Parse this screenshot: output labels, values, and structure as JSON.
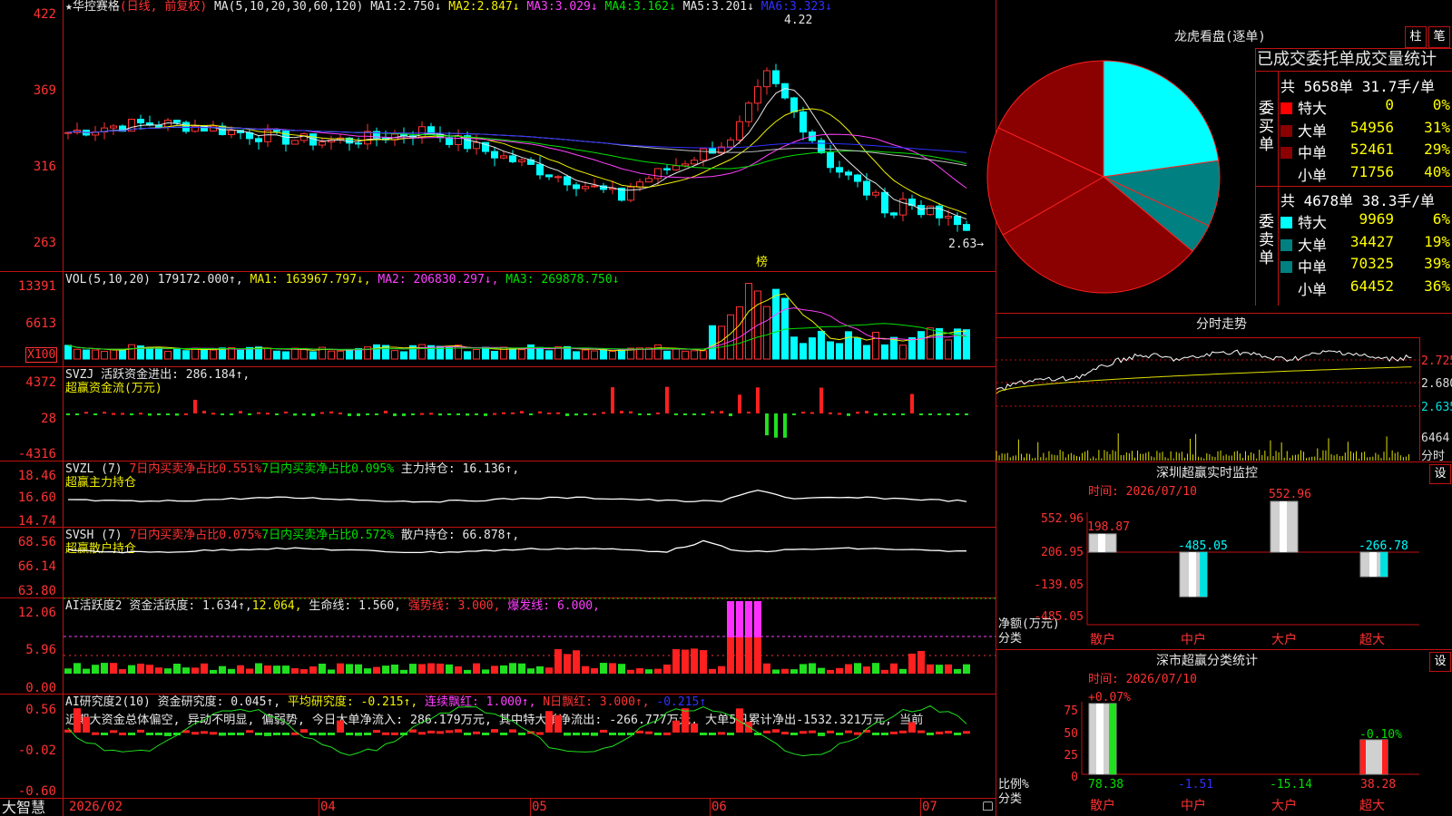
{
  "header": {
    "star": "★",
    "stock_name": "华控赛格",
    "mode": "(日线, 前复权)",
    "ma_params": "MA(5,10,20,30,60,120)",
    "ma": [
      {
        "label": "MA1:",
        "value": "2.750↓",
        "color": "#e6e6e6"
      },
      {
        "label": "MA2:",
        "value": "2.847↓",
        "color": "#f0f000"
      },
      {
        "label": "MA3:",
        "value": "3.029↓",
        "color": "#ff40ff"
      },
      {
        "label": "MA4:",
        "value": "3.162↓",
        "color": "#00e000"
      },
      {
        "label": "MA5:",
        "value": "3.201↓",
        "color": "#e6e6e6"
      },
      {
        "label": "MA6:",
        "value": "3.323↓",
        "color": "#3030ff"
      }
    ]
  },
  "main_chart": {
    "y_labels": [
      "422",
      "369",
      "316",
      "263"
    ],
    "high_label": "4.22",
    "low_label": "2.63→",
    "marker": "榜"
  },
  "vol": {
    "title": "VOL(5,10,20)",
    "value": "179172.000↑,",
    "ma1": "MA1: 163967.797↓,",
    "ma2": "MA2: 206830.297↓,",
    "ma3": "MA3: 269878.750↓",
    "y_labels": [
      "13391",
      "6613"
    ],
    "unit": "X100"
  },
  "svzj": {
    "title": "SVZJ",
    "text": "活跃资金进出: 286.184↑,",
    "sub": "超赢资金流(万元)",
    "y_labels": [
      "4372",
      "28",
      "-4316"
    ]
  },
  "svzl": {
    "title": "SVZL (7)",
    "red": "7日内买卖净占比0.551%",
    "green": "7日内买卖净占比0.095%",
    "white": "主力持仓: 16.136↑,",
    "sub": "超赢主力持仓",
    "y_labels": [
      "18.46",
      "16.60",
      "14.74"
    ]
  },
  "svsh": {
    "title": "SVSH (7)",
    "red": "7日内买卖净占比0.075%",
    "green": "7日内买卖净占比0.572%",
    "white": "散户持仓: 66.878↑,",
    "sub": "超赢散户持仓",
    "y_labels": [
      "68.56",
      "66.14",
      "63.80"
    ]
  },
  "ai_active": {
    "title": "AI活跃度2",
    "a": "资金活跃度: 1.634↑,",
    "b": "12.064,",
    "c": "生命线: 1.560,",
    "d": "强势线: 3.000,",
    "e": "爆发线: 6.000,",
    "y_labels": [
      "12.06",
      "5.96",
      "0.00"
    ]
  },
  "ai_research": {
    "title": "AI研究度2(10)",
    "a": "资金研究度: 0.045↑,",
    "b": "平均研究度: -0.215↑,",
    "c": "连续飘红: 1.000↑,",
    "d": "N日飘红: 3.000↑,",
    "e": "-0.215↑",
    "comment": "近期大资金总体偏空, 异动不明显, 偏弱势, 今日大单净流入: 286.179万元, 其中特大单净流出: -266.777万元, 大单5日累计净出-1532.321万元, 当前",
    "y_labels": [
      "0.56",
      "-0.02",
      "-0.60"
    ]
  },
  "bottom": {
    "brand": "大智慧",
    "dates": [
      "2026/02",
      "04",
      "05",
      "06",
      "07"
    ]
  },
  "lhb": {
    "title": "龙虎看盘(逐单)",
    "tab1": "柱",
    "tab2": "笔",
    "stats_title": "已成交委托单成交量统计",
    "buy_label": "委买单",
    "sell_label": "委卖单",
    "buy_total": "共 5658单 31.7手/单",
    "sell_total": "共 4678单 38.3手/单",
    "buy_rows": [
      {
        "name": "特大",
        "vol": "0",
        "pct": "0%",
        "color": "#ff0000"
      },
      {
        "name": "大单",
        "vol": "54956",
        "pct": "31%",
        "color": "#8b0000"
      },
      {
        "name": "中单",
        "vol": "52461",
        "pct": "29%",
        "color": "#8b0000"
      },
      {
        "name": "小单",
        "vol": "71756",
        "pct": "40%",
        "color": "#000000"
      }
    ],
    "sell_rows": [
      {
        "name": "特大",
        "vol": "9969",
        "pct": "6%",
        "color": "#00ffff"
      },
      {
        "name": "大单",
        "vol": "34427",
        "pct": "19%",
        "color": "#008080"
      },
      {
        "name": "中单",
        "vol": "70325",
        "pct": "39%",
        "color": "#008080"
      },
      {
        "name": "小单",
        "vol": "64452",
        "pct": "36%",
        "color": "#000000"
      }
    ]
  },
  "intraday": {
    "title": "分时走势",
    "y_labels": [
      "2.725",
      "2.680",
      "2.635"
    ],
    "vol_label": "6464",
    "vol_sub": "分时"
  },
  "sz_monitor": {
    "title": "深圳超赢实时监控",
    "btn": "设",
    "time": "时间: 2026/07/10",
    "y_labels": [
      "552.96",
      "206.95",
      "-139.05",
      "-485.05"
    ],
    "bars": [
      {
        "cat": "散户",
        "label": "198.87",
        "value": 198.87
      },
      {
        "cat": "中户",
        "label": "-485.05",
        "value": -485.05
      },
      {
        "cat": "大户",
        "label": "552.96",
        "value": 552.96
      },
      {
        "cat": "超大",
        "label": "-266.78",
        "value": -266.78
      }
    ],
    "axis_title": "净额(万元)",
    "axis_sub": "分类"
  },
  "sz_class": {
    "title": "深市超赢分类统计",
    "btn": "设",
    "time": "时间: 2026/07/10",
    "y_labels": [
      "75",
      "50",
      "25",
      "0"
    ],
    "top_labels": [
      "+0.07%",
      "-0.10%"
    ],
    "cats": [
      "散户",
      "中户",
      "大户",
      "超大"
    ],
    "values": [
      "78.38",
      "-1.51",
      "-15.14",
      "38.28"
    ],
    "axis_title": "比例%",
    "axis_sub": "分类"
  }
}
